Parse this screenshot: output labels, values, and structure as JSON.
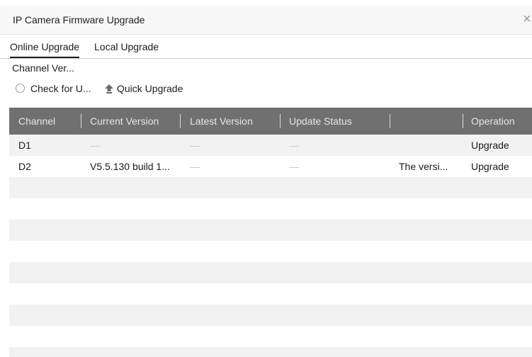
{
  "dialog": {
    "title": "IP Camera Firmware Upgrade",
    "close_glyph": "×"
  },
  "tabs": [
    {
      "label": "Online Upgrade",
      "active": true
    },
    {
      "label": "Local Upgrade",
      "active": false
    }
  ],
  "section_label": "Channel Ver...",
  "toolbar": {
    "check_label": "Check for U...",
    "quick_label": "Quick Upgrade",
    "quick_icon": "upload-arrow-icon"
  },
  "table": {
    "columns": [
      "Channel",
      "Current Version",
      "Latest Version",
      "Update Status",
      "",
      "Operation"
    ],
    "rows": [
      {
        "channel": "D1",
        "current": "—",
        "latest": "—",
        "status": "—",
        "info": "",
        "operation": "Upgrade"
      },
      {
        "channel": "D2",
        "current": "V5.5.130 build 1...",
        "latest": "—",
        "status": "—",
        "info": "The versi...",
        "operation": "Upgrade"
      }
    ]
  },
  "colors": {
    "header_bg": "#707070",
    "row_alt_bg": "#f2f2f2"
  }
}
